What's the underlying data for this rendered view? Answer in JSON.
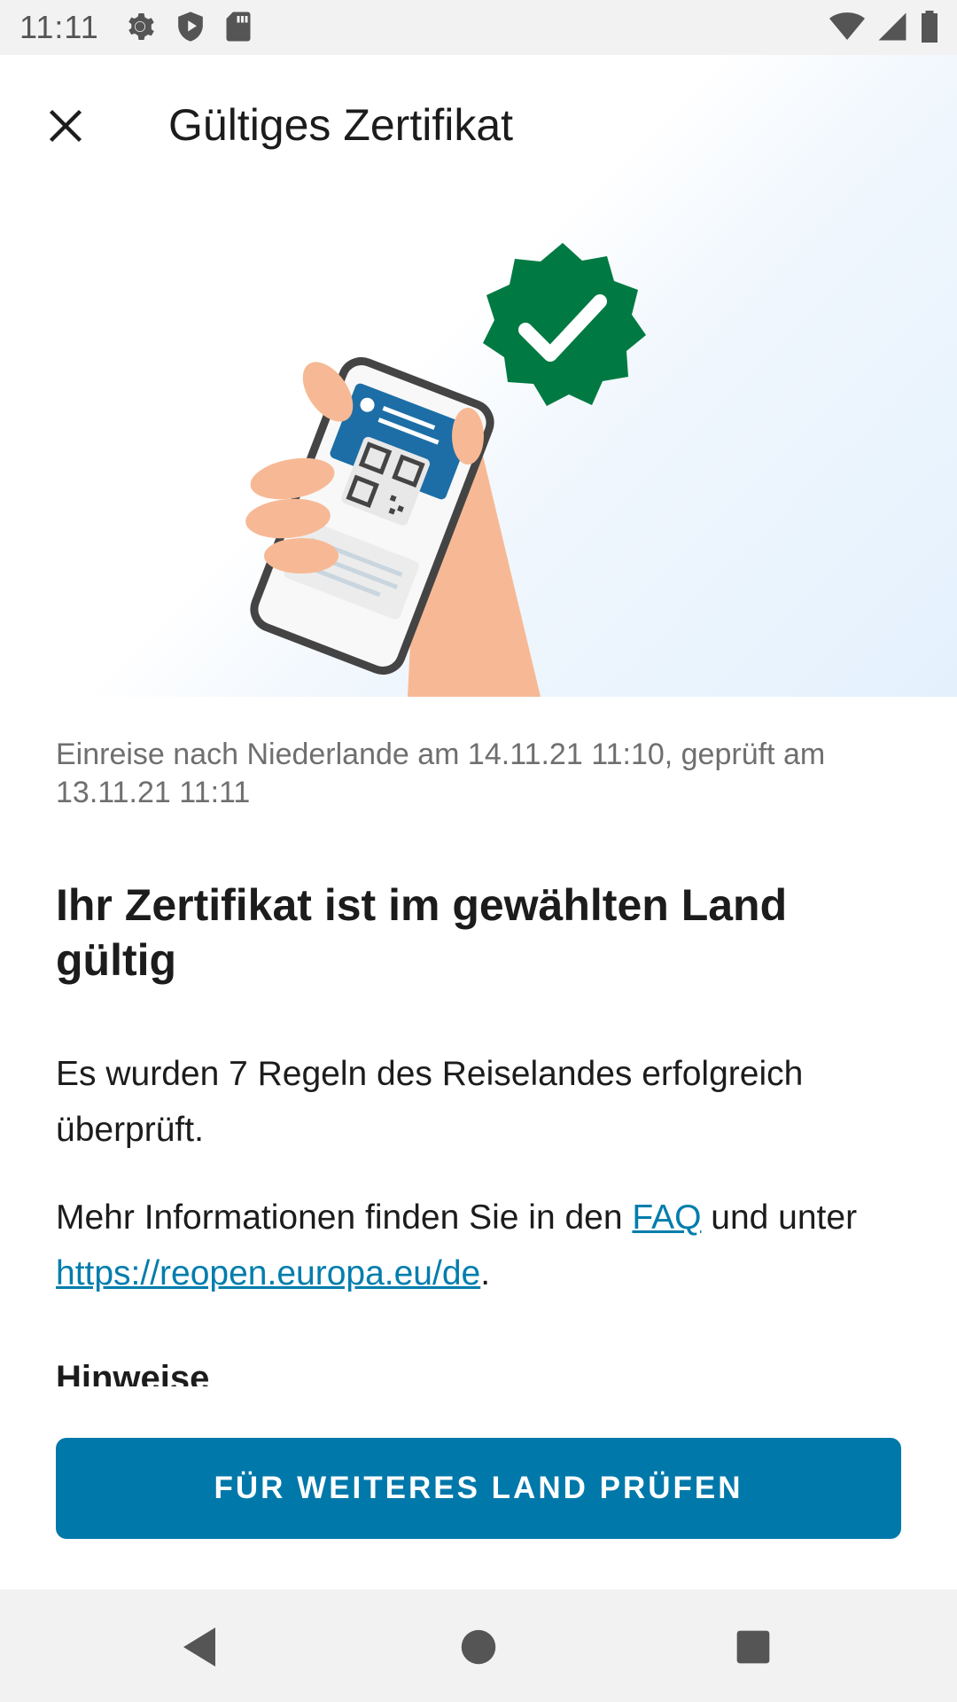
{
  "status_bar": {
    "time": "11:11",
    "left_icons": [
      "settings-icon",
      "shield-icon",
      "sd-card-icon"
    ],
    "right_icons": [
      "wifi-icon",
      "signal-icon",
      "battery-icon"
    ]
  },
  "header": {
    "close_icon": "close-icon",
    "title": "Gültiges Zertifikat"
  },
  "hero": {
    "illustration": "hand-holding-phone-with-qr-certificate",
    "badge_icon": "verified-check-badge-icon"
  },
  "content": {
    "entry_info": "Einreise nach Niederlande am 14.11.21 11:10, geprüft am 13.11.21 11:11",
    "result_heading": "Ihr Zertifikat ist im gewählten Land gültig",
    "rules_text": "Es wurden 7 Regeln des Reiselandes erfolgreich überprüft.",
    "more_info_prefix": "Mehr Informationen finden Sie in den ",
    "faq_link": "FAQ",
    "more_info_middle": " und unter ",
    "url_link": "https://reopen.europa.eu/de",
    "more_info_suffix": ".",
    "hints_heading": "Hinweise"
  },
  "button": {
    "label": "FÜR WEITERES LAND PRÜFEN"
  },
  "nav_bar": {
    "back_icon": "back-triangle-icon",
    "home_icon": "home-circle-icon",
    "recents_icon": "recents-square-icon"
  },
  "colors": {
    "accent": "#0078aa",
    "link": "#007dad",
    "badge_green": "#007a42",
    "skin": "#f7b995"
  }
}
